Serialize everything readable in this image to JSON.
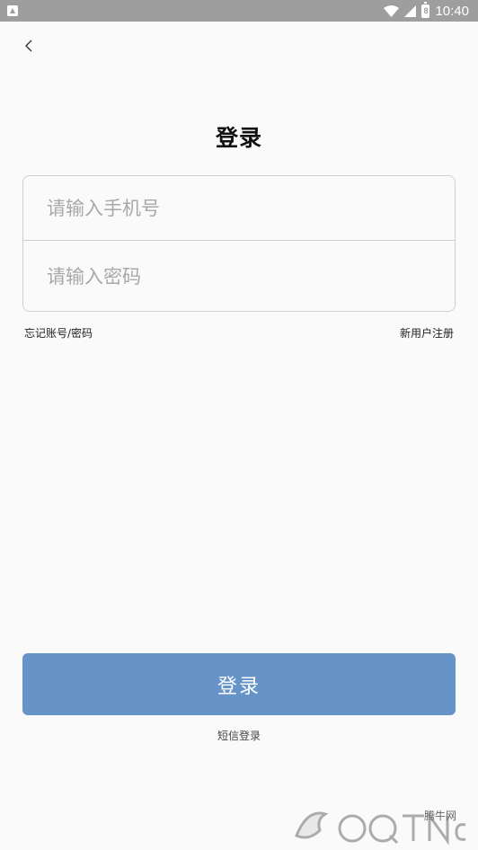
{
  "status_bar": {
    "time": "10:40",
    "battery_level": "8"
  },
  "header": {
    "title": "登录"
  },
  "form": {
    "phone_placeholder": "请输入手机号",
    "password_placeholder": "请输入密码"
  },
  "links": {
    "forgot": "忘记账号/密码",
    "register": "新用户注册"
  },
  "actions": {
    "login_label": "登录",
    "sms_login": "短信登录"
  },
  "watermark": {
    "site": "腾牛网",
    "brand": "QQTN.com"
  },
  "colors": {
    "accent": "#6693c8",
    "background": "#fafafa",
    "status_bar": "#9e9e9e"
  },
  "icons": {
    "back": "chevron-left-icon",
    "wifi": "wifi-icon",
    "signal": "signal-icon",
    "battery": "battery-icon",
    "notification": "app-notification-icon"
  }
}
